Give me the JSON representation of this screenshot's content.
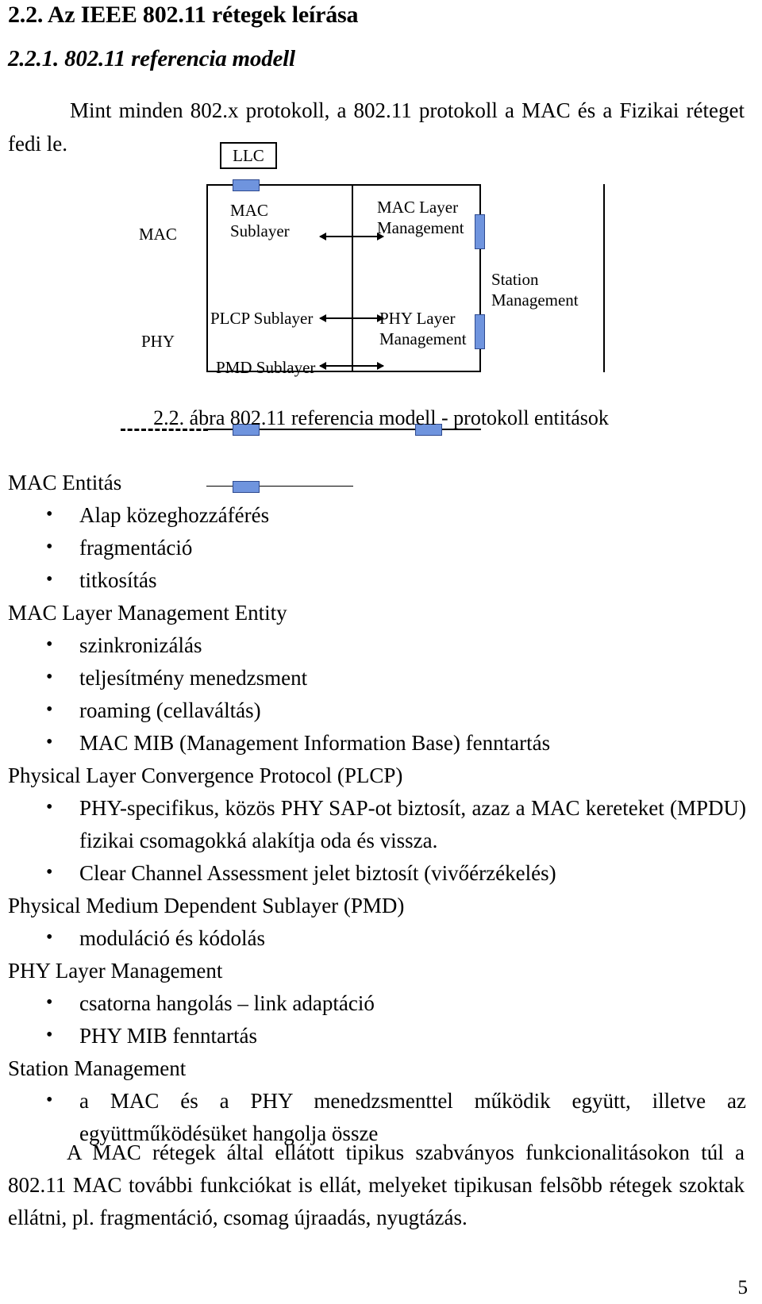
{
  "document": {
    "section_heading": "2.2. Az IEEE 802.11 rétegek leírása",
    "subsection_heading": "2.2.1. 802.11 referencia modell",
    "intro_paragraph": "Mint minden  802.x protokoll, a 802.11 protokoll a MAC és a Fizikai réteget fedi le.",
    "page_number": "5"
  },
  "figure": {
    "caption": "2.2. ábra 802.11 referencia modell - protokoll entitások",
    "llc_box": "LLC",
    "left_labels": {
      "mac": "MAC",
      "phy": "PHY"
    },
    "sublayers": {
      "mac_sublayer": "MAC\nSublayer",
      "plcp_sublayer": "PLCP Sublayer",
      "pmd_sublayer": "PMD Sublayer"
    },
    "management": {
      "mac_layer_management": "MAC Layer\nManagement",
      "phy_layer_management": "PHY Layer\nManagement",
      "station_management": "Station\nManagement"
    },
    "accent_color": "#6f94de",
    "accent_border_color": "#2e4a8f"
  },
  "sections": [
    {
      "title": "MAC Entitás",
      "items": [
        "Alap közeghozzáférés",
        "fragmentáció",
        "titkosítás"
      ]
    },
    {
      "title": "MAC Layer Management Entity",
      "items": [
        "szinkronizálás",
        "teljesítmény menedzsment",
        "roaming (cellaváltás)",
        "MAC MIB (Management Information Base) fenntartás"
      ]
    },
    {
      "title": "Physical Layer Convergence Protocol (PLCP)",
      "items": [
        "PHY-specifikus, közös PHY SAP-ot biztosít, azaz a MAC kereteket (MPDU) fizikai csomagokká alakítja oda és vissza.",
        "Clear Channel Assessment jelet biztosít (vivőérzékelés)"
      ]
    },
    {
      "title": "Physical Medium Dependent Sublayer (PMD)",
      "items": [
        "moduláció és kódolás"
      ]
    },
    {
      "title": "PHY Layer Management",
      "items": [
        "csatorna hangolás – link adaptáció",
        "PHY MIB fenntartás"
      ]
    },
    {
      "title": "Station Management",
      "items": [
        "a MAC és a PHY menedzsmenttel működik együtt, illetve az együttműködésüket hangolja össze"
      ]
    }
  ],
  "closing_paragraph": "A MAC rétegek által ellátott tipikus szabványos funkcionalitásokon túl a 802.11 MAC további funkciókat is ellát, melyeket tipikusan felsõbb rétegek szoktak ellátni, pl. fragmentáció, csomag újraadás, nyugtázás."
}
